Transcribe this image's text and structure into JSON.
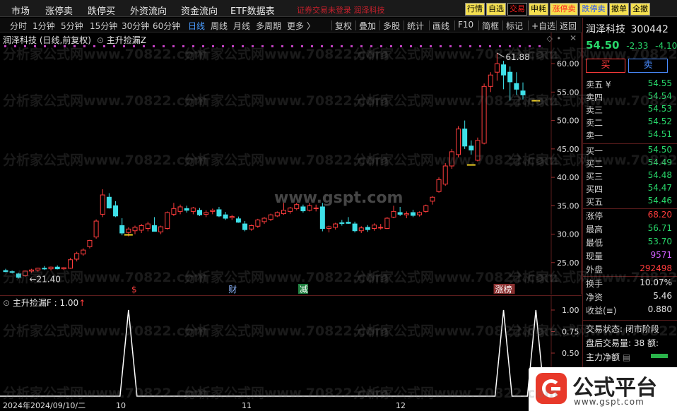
{
  "menu": [
    "市场",
    "涨停卖",
    "跌停买",
    "外资流向",
    "资金流向",
    "ETF数据表"
  ],
  "notice": "证券交易未登录   润泽科技",
  "top_buttons": [
    {
      "label": "行情",
      "fg": "#000000",
      "bg": "#f5e050"
    },
    {
      "label": "自选",
      "fg": "#000000",
      "bg": "#f5e050"
    },
    {
      "label": "交易",
      "fg": "#ff2020",
      "bg": "#000000"
    },
    {
      "label": "申耗",
      "fg": "#000000",
      "bg": "#f5e050"
    },
    {
      "label": "涨停卖",
      "fg": "#ff2020",
      "bg": "#f5e050"
    },
    {
      "label": "跌停卖",
      "fg": "#2050ff",
      "bg": "#f5e050"
    },
    {
      "label": "撤单",
      "fg": "#000000",
      "bg": "#f5e050"
    },
    {
      "label": "全撤",
      "fg": "#000000",
      "bg": "#f5e050"
    }
  ],
  "periods": [
    "分时",
    "1分钟",
    "5分钟",
    "15分钟",
    "30分钟",
    "60分钟",
    "日线",
    "周线",
    "月线",
    "多周期",
    "更多 〉"
  ],
  "active_period": "日线",
  "tools": [
    "复权",
    "叠加",
    "多股",
    "统计",
    "画线",
    "F10",
    "简框",
    "标记",
    "+自选",
    "返回"
  ],
  "chart_header": {
    "title": "润泽科技 (日线,前复权)",
    "indicator": "主升捡漏Z"
  },
  "sub_header": "主升捡漏F : 1.00",
  "sub_arrow": "↑",
  "price_labels": {
    "high": "61.88",
    "low": "21.40"
  },
  "y_ticks": [
    "60.00",
    "55.00",
    "50.00",
    "45.00",
    "40.00",
    "35.00",
    "30.00",
    "25.00"
  ],
  "sub_y_ticks": [
    "1.00",
    "0.75",
    "0.50"
  ],
  "x_labels": {
    "start": "2024年2024/09/10/二",
    "m1": "10",
    "m2": "11",
    "m3": "12"
  },
  "event_marks": [
    {
      "text": "$",
      "color": "#ff4040"
    },
    {
      "text": "财",
      "color": "#8fb8ff"
    },
    {
      "text": "减",
      "color": "#ffffff"
    },
    {
      "text": "涨榜",
      "color": "#ffffff"
    }
  ],
  "watermarks": [
    "分析家公式网www.70822.com",
    "www.gspt.com"
  ],
  "panel": {
    "name": "润泽科技",
    "code": "300442",
    "price": "54.50",
    "change": "-2.33",
    "pct": "-4.10",
    "buy_btn": "买",
    "sell_btn": "卖",
    "sells": [
      {
        "label": "卖五 ¥",
        "price": "54.55"
      },
      {
        "label": "卖四",
        "price": "54.54"
      },
      {
        "label": "卖三",
        "price": "54.53"
      },
      {
        "label": "卖二",
        "price": "54.52"
      },
      {
        "label": "卖一",
        "price": "54.51"
      }
    ],
    "buys": [
      {
        "label": "买一",
        "price": "54.50"
      },
      {
        "label": "买二",
        "price": "54.49"
      },
      {
        "label": "买三",
        "price": "54.48"
      },
      {
        "label": "买四",
        "price": "54.47"
      },
      {
        "label": "买五",
        "price": "54.46"
      }
    ],
    "stats": [
      {
        "label": "涨停",
        "value": "68.20",
        "color": "#ff3c3c"
      },
      {
        "label": "最高",
        "value": "56.71",
        "color": "#28d76a"
      },
      {
        "label": "最低",
        "value": "53.70",
        "color": "#28d76a"
      },
      {
        "label": "现量",
        "value": "9571",
        "color": "#d060ff"
      },
      {
        "label": "外盘",
        "value": "292498",
        "color": "#ff3c3c"
      }
    ],
    "stats2": [
      {
        "label": "换手",
        "value": "10.07%",
        "color": "#e6e6e6"
      },
      {
        "label": "净资",
        "value": "5.46",
        "color": "#e6e6e6"
      },
      {
        "label": "收益(≡)",
        "value": "0.880",
        "color": "#e6e6e6"
      }
    ],
    "trade_status": "交易状态: 闭市阶段",
    "after_hours": "盘后交易量: 38  额:",
    "main_flow": "主力净额"
  },
  "logo": {
    "text": "公式平台",
    "url": "www.gspt.com"
  },
  "chart_data": {
    "type": "candlestick",
    "ylim": [
      21,
      63
    ],
    "ohlc": [
      [
        23.6,
        23.9,
        23.3,
        23.4
      ],
      [
        23.4,
        23.6,
        23.1,
        23.3
      ],
      [
        23.0,
        23.2,
        22.2,
        22.4
      ],
      [
        22.7,
        23.6,
        22.5,
        23.5
      ],
      [
        23.5,
        23.9,
        23.2,
        23.7
      ],
      [
        23.7,
        24.1,
        23.4,
        24.0
      ],
      [
        24.0,
        24.4,
        23.7,
        23.9
      ],
      [
        23.9,
        24.3,
        23.6,
        24.2
      ],
      [
        24.2,
        24.5,
        23.8,
        23.9
      ],
      [
        23.9,
        24.2,
        23.7,
        24.1
      ],
      [
        24.0,
        25.8,
        23.9,
        25.5
      ],
      [
        25.6,
        26.9,
        25.2,
        26.6
      ],
      [
        26.5,
        27.5,
        26.2,
        27.2
      ],
      [
        27.8,
        29.0,
        27.5,
        28.9
      ],
      [
        29.5,
        32.6,
        29.2,
        32.3
      ],
      [
        33.5,
        37.9,
        33.0,
        36.9
      ],
      [
        36.5,
        37.2,
        34.5,
        34.6
      ],
      [
        35.0,
        35.8,
        33.0,
        33.2
      ],
      [
        31.5,
        32.8,
        29.8,
        30.2
      ],
      [
        30.3,
        31.2,
        29.6,
        30.9
      ],
      [
        30.6,
        31.5,
        30.0,
        31.2
      ],
      [
        30.7,
        31.8,
        30.2,
        31.5
      ],
      [
        31.0,
        32.2,
        30.5,
        31.8
      ],
      [
        31.5,
        33.0,
        31.2,
        30.5
      ],
      [
        30.4,
        31.5,
        30.0,
        31.3
      ],
      [
        31.0,
        34.0,
        30.8,
        33.8
      ],
      [
        33.5,
        35.5,
        33.2,
        34.5
      ],
      [
        34.0,
        35.2,
        33.5,
        34.8
      ],
      [
        34.5,
        35.0,
        33.8,
        34.2
      ],
      [
        34.0,
        34.8,
        33.5,
        34.6
      ],
      [
        34.2,
        34.6,
        33.2,
        33.4
      ],
      [
        33.5,
        34.2,
        33.0,
        33.8
      ],
      [
        34.0,
        34.5,
        33.5,
        34.2
      ],
      [
        34.3,
        34.8,
        33.0,
        33.2
      ],
      [
        33.4,
        33.9,
        32.5,
        32.8
      ],
      [
        32.9,
        33.4,
        32.5,
        33.1
      ],
      [
        32.7,
        33.1,
        32.0,
        32.1
      ],
      [
        31.8,
        32.3,
        30.5,
        30.8
      ],
      [
        30.9,
        31.7,
        30.6,
        31.5
      ],
      [
        31.4,
        32.7,
        31.1,
        32.5
      ],
      [
        32.2,
        33.0,
        31.8,
        32.8
      ],
      [
        32.6,
        33.6,
        32.3,
        33.4
      ],
      [
        33.2,
        34.0,
        33.0,
        33.8
      ],
      [
        33.6,
        35.5,
        33.4,
        34.2
      ],
      [
        34.0,
        34.8,
        33.6,
        34.6
      ],
      [
        34.5,
        35.5,
        34.2,
        35.2
      ],
      [
        34.8,
        35.2,
        33.8,
        34.1
      ],
      [
        34.2,
        35.5,
        34.0,
        35.0
      ],
      [
        34.5,
        35.2,
        34.0,
        34.6
      ],
      [
        34.8,
        35.5,
        30.5,
        31.0
      ],
      [
        31.0,
        31.5,
        30.3,
        31.3
      ],
      [
        31.2,
        32.0,
        30.8,
        31.8
      ],
      [
        32.0,
        32.5,
        31.5,
        31.9
      ],
      [
        32.1,
        33.0,
        31.8,
        31.9
      ],
      [
        31.8,
        32.2,
        30.3,
        30.6
      ],
      [
        30.6,
        31.4,
        30.2,
        31.1
      ],
      [
        31.2,
        31.6,
        30.4,
        30.8
      ],
      [
        31.0,
        31.9,
        30.6,
        31.6
      ],
      [
        31.2,
        31.8,
        30.8,
        31.2
      ],
      [
        31.0,
        33.0,
        30.9,
        32.8
      ],
      [
        33.0,
        35.0,
        32.8,
        34.0
      ],
      [
        33.8,
        34.8,
        33.2,
        33.5
      ],
      [
        33.4,
        34.0,
        32.8,
        33.6
      ],
      [
        33.8,
        34.3,
        33.0,
        33.3
      ],
      [
        33.4,
        34.0,
        33.1,
        33.8
      ],
      [
        34.0,
        35.2,
        33.8,
        35.0
      ],
      [
        35.8,
        36.7,
        35.2,
        36.5
      ],
      [
        37.5,
        40.0,
        37.3,
        39.6
      ],
      [
        38.8,
        42.5,
        38.5,
        42.0
      ],
      [
        42.0,
        45.0,
        41.5,
        44.5
      ],
      [
        44.0,
        49.0,
        43.5,
        48.5
      ],
      [
        48.5,
        50.0,
        45.0,
        45.5
      ],
      [
        45.5,
        46.5,
        44.0,
        44.8
      ],
      [
        43.0,
        47.0,
        42.8,
        46.5
      ],
      [
        46.0,
        56.5,
        45.8,
        56.0
      ],
      [
        56.0,
        58.5,
        55.0,
        58.0
      ],
      [
        58.5,
        61.9,
        57.0,
        60.0
      ],
      [
        59.8,
        60.5,
        55.5,
        58.0
      ],
      [
        58.5,
        59.5,
        53.5,
        56.8
      ],
      [
        56.5,
        58.5,
        54.5,
        55.5
      ],
      [
        55.2,
        56.7,
        53.7,
        54.5
      ]
    ],
    "sub_spikes": [
      19,
      77,
      82
    ],
    "sub_ylim": [
      0,
      1
    ]
  }
}
